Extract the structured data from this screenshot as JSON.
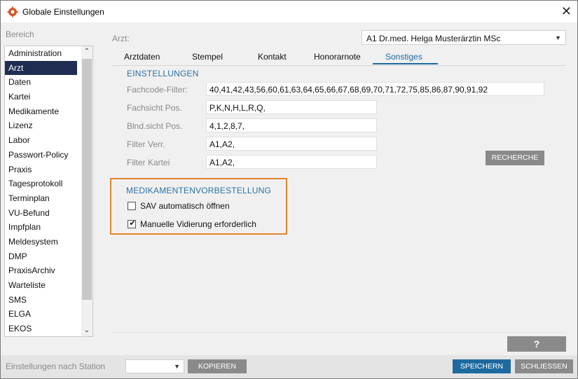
{
  "window": {
    "title": "Globale Einstellungen",
    "app_icon": "gear-logo-icon",
    "close_glyph": "✕"
  },
  "sidebar": {
    "heading": "Bereich",
    "items": [
      "Administration",
      "Arzt",
      "Daten",
      "Kartei",
      "Medikamente",
      "Lizenz",
      "Labor",
      "Passwort-Policy",
      "Praxis",
      "Tagesprotokoll",
      "Terminplan",
      "VU-Befund",
      "Impfplan",
      "Meldesystem",
      "DMP",
      "PraxisArchiv",
      "Warteliste",
      "SMS",
      "ELGA",
      "EKOS"
    ],
    "selected": "Arzt"
  },
  "header": {
    "arzt_label": "Arzt:",
    "arzt_value": "A1 Dr.med. Helga Musterärztin MSc"
  },
  "tabs": [
    "Arztdaten",
    "Stempel",
    "Kontakt",
    "Honorarnote",
    "Sonstiges"
  ],
  "active_tab": "Sonstiges",
  "einstellungen": {
    "title": "EINSTELLUNGEN",
    "fields": [
      {
        "label": "Fachcode-Filter:",
        "value": "40,41,42,43,56,60,61,63,64,65,66,67,68,69,70,71,72,75,85,86,87,90,91,92"
      },
      {
        "label": "Fachsicht Pos.",
        "value": "P,K,N,H,L,R,Q,"
      },
      {
        "label": "Blnd.sicht Pos.",
        "value": "4,1,2,8,7,"
      },
      {
        "label": "Filter Verr.",
        "value": "A1,A2,"
      },
      {
        "label": "Filter Kartei",
        "value": "A1,A2,"
      }
    ],
    "recherche_button": "RECHERCHE"
  },
  "medikamente": {
    "title": "MEDIKAMENTENVORBESTELLUNG",
    "options": [
      {
        "label": "SAV automatisch öffnen",
        "checked": false
      },
      {
        "label": "Manuelle Vidierung erforderlich",
        "checked": true
      }
    ]
  },
  "help_button": "?",
  "footer": {
    "station_label": "Einstellungen nach Station",
    "station_value": "",
    "copy_button": "KOPIEREN",
    "save_button": "SPEICHERN",
    "close_button": "SCHLIESSEN"
  },
  "colors": {
    "accent": "#1e6aa0",
    "selected_bg": "#1f2d52",
    "highlight_box": "#e3862f",
    "gray_button": "#8a8a8a"
  }
}
